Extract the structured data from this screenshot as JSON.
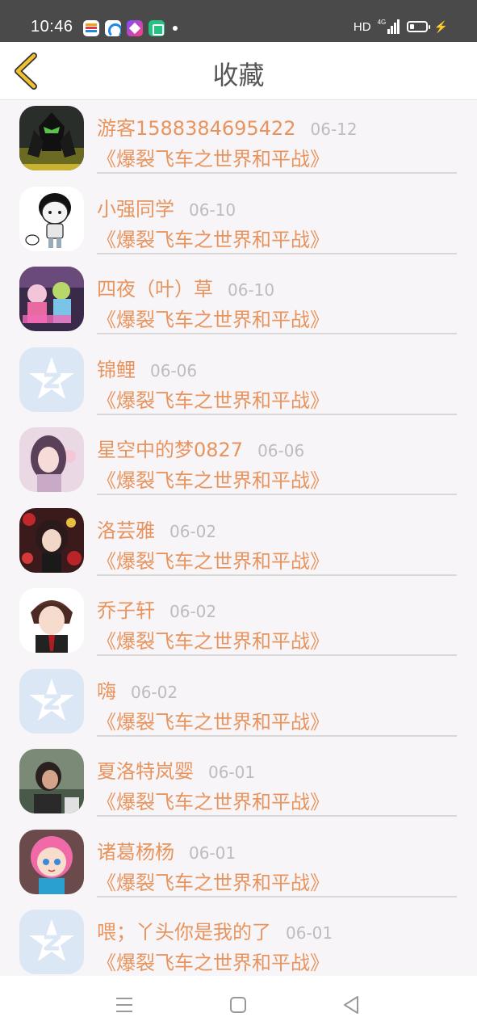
{
  "status_bar": {
    "time": "10:46",
    "network": "HD",
    "signal_tag": "4G",
    "notification_icons": [
      "calendar-app-icon",
      "cloud-app-icon",
      "shortcut-app-icon",
      "chat-app-icon"
    ]
  },
  "header": {
    "title": "收藏",
    "back_icon": "chevron-left-icon",
    "back_color": "#f0c030"
  },
  "colors": {
    "accent_text": "#e8945e",
    "date_text": "#bdbdbd",
    "background": "#f7f5f7"
  },
  "favorites": [
    {
      "name": "游客1588384695422",
      "date": "06-12",
      "game": "《爆裂飞车之世界和平战》",
      "avatar": "dark-robot-avatar"
    },
    {
      "name": "小强同学",
      "date": "06-10",
      "game": "《爆裂飞车之世界和平战》",
      "avatar": "cartoon-boy-avatar"
    },
    {
      "name": "四夜（叶）草",
      "date": "06-10",
      "game": "《爆裂飞车之世界和平战》",
      "avatar": "colorful-anime-avatar"
    },
    {
      "name": "锦鲤",
      "date": "06-06",
      "game": "《爆裂飞车之世界和平战》",
      "avatar": "default-qq-avatar"
    },
    {
      "name": "星空中的梦0827",
      "date": "06-06",
      "game": "《爆裂飞车之世界和平战》",
      "avatar": "pink-girl-avatar"
    },
    {
      "name": "洛芸雅",
      "date": "06-02",
      "game": "《爆裂飞车之世界和平战》",
      "avatar": "anime-girl-roses-avatar"
    },
    {
      "name": "乔子轩",
      "date": "06-02",
      "game": "《爆裂飞车之世界和平战》",
      "avatar": "anime-boy-avatar"
    },
    {
      "name": "嗨",
      "date": "06-02",
      "game": "《爆裂飞车之世界和平战》",
      "avatar": "default-qq-avatar"
    },
    {
      "name": "夏洛特岚婴",
      "date": "06-01",
      "game": "《爆裂飞车之世界和平战》",
      "avatar": "photo-woman-avatar"
    },
    {
      "name": "诸葛杨杨",
      "date": "06-01",
      "game": "《爆裂飞车之世界和平战》",
      "avatar": "pink-hair-doll-avatar"
    },
    {
      "name": "喂；丫头你是我的了",
      "date": "06-01",
      "game": "《爆裂飞车之世界和平战》",
      "avatar": "default-qq-avatar"
    }
  ],
  "nav_bar": {
    "buttons": [
      "menu-icon",
      "home-icon",
      "back-triangle-icon"
    ]
  }
}
